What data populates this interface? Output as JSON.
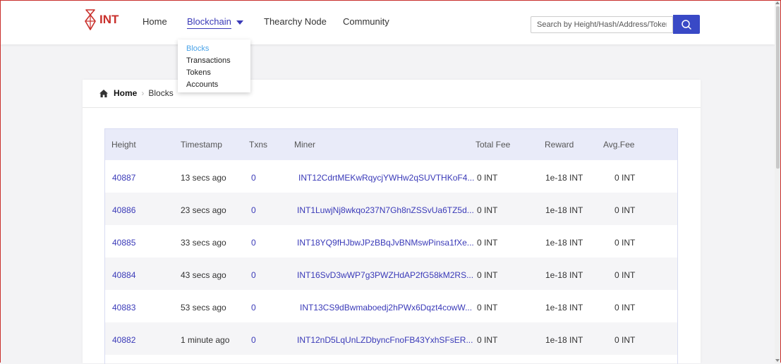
{
  "brand": {
    "logo_text": "INT",
    "color": "#c9302c"
  },
  "nav": {
    "home": "Home",
    "blockchain": "Blockchain",
    "node": "Thearchy Node",
    "community": "Community"
  },
  "search": {
    "placeholder": "Search by Height/Hash/Address/Token",
    "icon": "search-icon",
    "accent": "#3949c6"
  },
  "dropdown": {
    "items": [
      {
        "label": "Blocks",
        "active": true
      },
      {
        "label": "Transactions"
      },
      {
        "label": "Tokens"
      },
      {
        "label": "Accounts"
      }
    ]
  },
  "breadcrumb": {
    "home": "Home",
    "current": "Blocks"
  },
  "table": {
    "headers": [
      "Height",
      "Timestamp",
      "Txns",
      "Miner",
      "Total Fee",
      "Reward",
      "Avg.Fee"
    ],
    "rows": [
      {
        "height": "40887",
        "timestamp": "13 secs ago",
        "txns": "0",
        "miner": "INT12CdrtMEKwRqycjYWHw2qSUVTHKoF4...",
        "total_fee": "0 INT",
        "reward": "1e-18 INT",
        "avg_fee": "0 INT"
      },
      {
        "height": "40886",
        "timestamp": "23 secs ago",
        "txns": "0",
        "miner": "INT1LuwjNj8wkqo237N7Gh8nZSSvUa6TZ5d...",
        "total_fee": "0 INT",
        "reward": "1e-18 INT",
        "avg_fee": "0 INT"
      },
      {
        "height": "40885",
        "timestamp": "33 secs ago",
        "txns": "0",
        "miner": "INT18YQ9fHJbwJPzBBqJvBNMswPinsa1fXe...",
        "total_fee": "0 INT",
        "reward": "1e-18 INT",
        "avg_fee": "0 INT"
      },
      {
        "height": "40884",
        "timestamp": "43 secs ago",
        "txns": "0",
        "miner": "INT16SvD3wWP7g3PWZHdAP2fG58kM2RS...",
        "total_fee": "0 INT",
        "reward": "1e-18 INT",
        "avg_fee": "0 INT"
      },
      {
        "height": "40883",
        "timestamp": "53 secs ago",
        "txns": "0",
        "miner": "INT13CS9dBwmaboedj2hPWx6Dqzt4cowW...",
        "total_fee": "0 INT",
        "reward": "1e-18 INT",
        "avg_fee": "0 INT"
      },
      {
        "height": "40882",
        "timestamp": "1 minute ago",
        "txns": "0",
        "miner": "INT12nD5LqUnLZDbyncFnoFB43YxhSFsER...",
        "total_fee": "0 INT",
        "reward": "1e-18 INT",
        "avg_fee": "0 INT"
      }
    ]
  }
}
